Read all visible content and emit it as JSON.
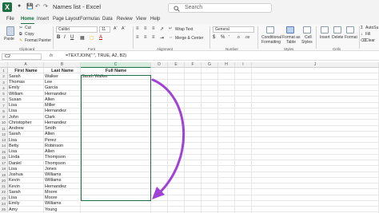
{
  "titlebar": {
    "app_letter": "X",
    "doc_title": "Names list - Excel",
    "search_placeholder": "Search"
  },
  "menu": [
    "File",
    "Home",
    "Insert",
    "Page Layout",
    "Formulas",
    "Data",
    "Review",
    "View",
    "Help"
  ],
  "menu_active": "Home",
  "ribbon": {
    "paste_label": "Paste",
    "cut_label": "Cut",
    "copy_label": "Copy",
    "format_painter_label": "Format Painter",
    "clipboard_group": "Clipboard",
    "font_name": "Calibri",
    "font_size": "11",
    "font_group": "Font",
    "wrap_text": "Wrap Text",
    "merge_center": "Merge & Center",
    "alignment_group": "Alignment",
    "number_format": "General",
    "number_group": "Number",
    "conditional_formatting_1": "Conditional",
    "conditional_formatting_2": "Formatting",
    "format_as_table_1": "Format as",
    "format_as_table_2": "Table",
    "cell_styles_1": "Cell",
    "cell_styles_2": "Styles",
    "styles_group": "Styles",
    "insert_label": "Insert",
    "delete_label": "Delete",
    "format_label": "Format",
    "cells_group": "Cells",
    "autosum_label": "AutoSu",
    "fill_label": "Fill",
    "clear_label": "Clear"
  },
  "formula_bar": {
    "name_box": "C2",
    "fx": "fx",
    "formula": "=TEXTJOIN(\" \", TRUE, A2, B2)"
  },
  "columns": [
    "A",
    "B",
    "C",
    "D",
    "E",
    "F",
    "G",
    "H",
    "I",
    "J"
  ],
  "selected_column": "C",
  "headers": {
    "first_name": "First Name",
    "last_name": "Last Name",
    "full_name": "Full Name"
  },
  "rows": [
    {
      "num": "1"
    },
    {
      "num": "2",
      "first": "Sarah",
      "last": "Walker",
      "full": "Sarah Walker"
    },
    {
      "num": "3",
      "first": "Thomas",
      "last": "Lee"
    },
    {
      "num": "4",
      "first": "Emily",
      "last": "Garcia"
    },
    {
      "num": "5",
      "first": "William",
      "last": "Hernandez"
    },
    {
      "num": "6",
      "first": "Susan",
      "last": "Allen"
    },
    {
      "num": "7",
      "first": "Lisa",
      "last": "Miller"
    },
    {
      "num": "8",
      "first": "Lisa",
      "last": "Hernandez"
    },
    {
      "num": "9",
      "first": "John",
      "last": "Clark"
    },
    {
      "num": "10",
      "first": "Christopher",
      "last": "Hernandez"
    },
    {
      "num": "11",
      "first": "Andrew",
      "last": "Smith"
    },
    {
      "num": "12",
      "first": "Sarah",
      "last": "Allen"
    },
    {
      "num": "13",
      "first": "Lisa",
      "last": "Perez"
    },
    {
      "num": "14",
      "first": "Betty",
      "last": "Robinson"
    },
    {
      "num": "15",
      "first": "Lisa",
      "last": "Allen"
    },
    {
      "num": "16",
      "first": "Linda",
      "last": "Thompson"
    },
    {
      "num": "17",
      "first": "Daniel",
      "last": "Thompson"
    },
    {
      "num": "18",
      "first": "Lisa",
      "last": "Jones"
    },
    {
      "num": "19",
      "first": "Joshua",
      "last": "Williams"
    },
    {
      "num": "20",
      "first": "Kevin",
      "last": "Williams"
    },
    {
      "num": "21",
      "first": "Kevin",
      "last": "Hernandez"
    },
    {
      "num": "22",
      "first": "Sarah",
      "last": "Moore"
    },
    {
      "num": "23",
      "first": "Lisa",
      "last": "Moore"
    },
    {
      "num": "24",
      "first": "Emily",
      "last": "Williams"
    },
    {
      "num": "25",
      "first": "Amy",
      "last": "Young"
    }
  ],
  "colors": {
    "excel_green": "#1d6f42",
    "arrow_purple": "#a142d6"
  }
}
